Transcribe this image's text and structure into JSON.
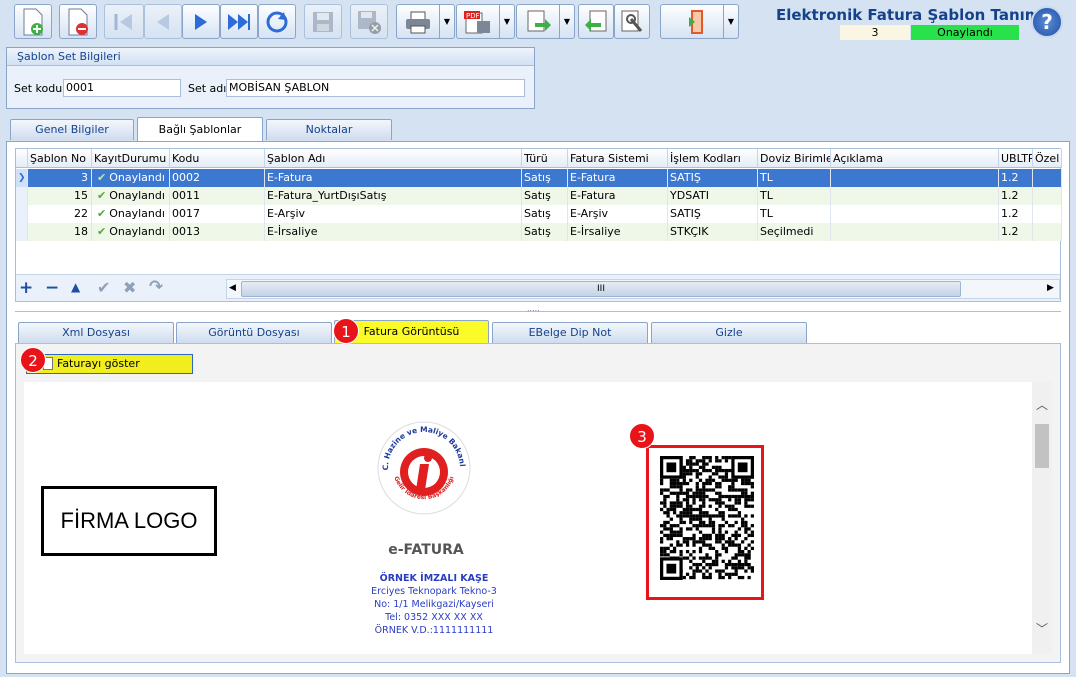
{
  "title": "Elektronik Fatura Şablon Tanımı",
  "status": {
    "count": "3",
    "state": "Onaylandı",
    "state_color": "#27e24a"
  },
  "toolbar": {
    "icons": [
      "new-doc-icon",
      "delete-doc-icon",
      "first-icon",
      "prev-icon",
      "next-icon",
      "last-icon",
      "refresh-icon",
      "save-icon",
      "cancel-save-icon",
      "print-icon",
      "pdf-icon",
      "export-icon",
      "import-icon",
      "tool-icon",
      "exit-icon",
      "help-icon"
    ]
  },
  "set": {
    "header": "Şablon Set Bilgileri",
    "code_label": "Set kodu",
    "code_value": "0001",
    "name_label": "Set adı",
    "name_value": "MOBİSAN ŞABLON"
  },
  "tabs": [
    "Genel Bilgiler",
    "Bağlı Şablonlar",
    "Noktalar"
  ],
  "grid": {
    "columns": [
      "Şablon No",
      "KayıtDurumu",
      "Kodu",
      "Şablon Adı",
      "Türü",
      "Fatura Sistemi",
      "İşlem Kodları",
      "Doviz Birimleri",
      "Açıklama",
      "UBLTR",
      "Özel N"
    ],
    "rows": [
      [
        "3",
        "Onaylandı",
        "0002",
        "E-Fatura",
        "Satış",
        "E-Fatura",
        "SATIŞ",
        "TL",
        "",
        "1.2",
        ""
      ],
      [
        "15",
        "Onaylandı",
        "0011",
        "E-Fatura_YurtDışıSatış",
        "Satış",
        "E-Fatura",
        "YDSATI",
        "TL",
        "",
        "1.2",
        ""
      ],
      [
        "22",
        "Onaylandı",
        "0017",
        "E-Arşiv",
        "Satış",
        "E-Arşiv",
        "SATIŞ",
        "TL",
        "",
        "1.2",
        ""
      ],
      [
        "18",
        "Onaylandı",
        "0013",
        "E-İrsaliye",
        "Satış",
        "E-İrsaliye",
        "STKÇIK",
        "Seçilmedi",
        "",
        "1.2",
        ""
      ]
    ],
    "scroll_grip": "III",
    "splitter": "....."
  },
  "subtabs": [
    "Xml Dosyası",
    "Görüntü Dosyası",
    "Fatura Görüntüsü",
    "EBelge Dip Not",
    "Gizle"
  ],
  "show_button": "Faturayı göster",
  "badges": [
    "1",
    "2",
    "3"
  ],
  "preview": {
    "logo_text": "FİRMA LOGO",
    "seal_text": "T.C. Hazine ve Maliye Bakanlığı",
    "seal_bottom": "Gelir İdaresi Başkanlığı",
    "efatura": "e-FATURA",
    "stamp": [
      "ÖRNEK İMZALI KAŞE",
      "Erciyes Teknopark Tekno-3",
      "No: 1/1 Melikgazi/Kayseri",
      "Tel: 0352 XXX XX XX",
      "ÖRNEK V.D.:1111111111"
    ]
  }
}
